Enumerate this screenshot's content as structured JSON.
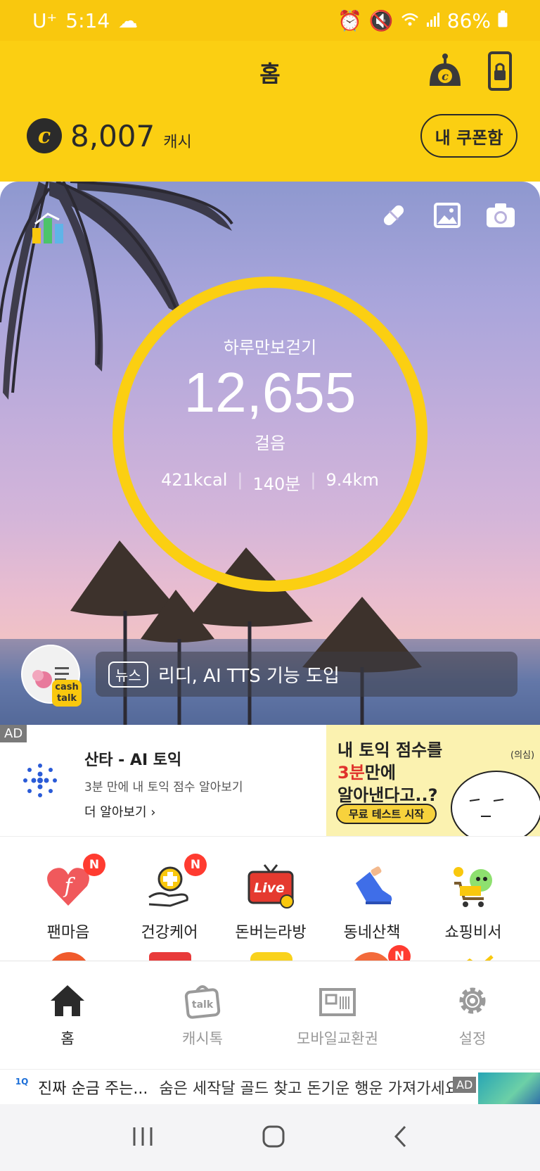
{
  "status_bar": {
    "carrier": "U⁺",
    "time": "5:14",
    "battery": "86%"
  },
  "header": {
    "title": "홈",
    "cash_amount": "8,007",
    "cash_unit": "캐시",
    "coupon_button": "내 쿠폰함",
    "coin_letter": "c"
  },
  "steps": {
    "label": "하루만보걷기",
    "count": "12,655",
    "unit": "걸음",
    "kcal": "421kcal",
    "minutes": "140분",
    "distance": "9.4km",
    "ring_color": "#fbcf12"
  },
  "news": {
    "tag": "뉴스",
    "text": "리디, AI TTS 기능 도입",
    "badge_line1": "cash",
    "badge_line2": "talk"
  },
  "ad": {
    "badge": "AD",
    "title": "산타 - AI 토익",
    "subtitle": "3분 만에 내 토익 점수 알아보기",
    "more": "더 알아보기",
    "banner_line1": "내 토익 점수를",
    "banner_line2_red": "3분",
    "banner_line2_rest": "만에",
    "banner_line3": "알아낸다고..?",
    "banner_cta": "무료 테스트 시작",
    "banner_doubt": "(의심)"
  },
  "menu": {
    "items": [
      {
        "label": "팬마음",
        "badge": "N",
        "icon": "fan-heart-icon"
      },
      {
        "label": "건강케어",
        "badge": "N",
        "icon": "health-care-icon"
      },
      {
        "label": "돈버는라방",
        "badge": "",
        "icon": "live-tv-icon",
        "live": "Live"
      },
      {
        "label": "동네산책",
        "badge": "",
        "icon": "sneaker-icon"
      },
      {
        "label": "쇼핑비서",
        "badge": "",
        "icon": "shopping-cart-icon"
      }
    ],
    "second_row_badge": "N"
  },
  "bottom_nav": {
    "items": [
      {
        "label": "홈",
        "icon": "home-icon",
        "active": true
      },
      {
        "label": "캐시톡",
        "icon": "cashtalk-bag-icon",
        "active": false
      },
      {
        "label": "모바일교환권",
        "icon": "voucher-icon",
        "active": false
      },
      {
        "label": "설정",
        "icon": "gear-icon",
        "active": false
      }
    ]
  },
  "bottom_ad": {
    "logo": "1Q",
    "text1": "진짜 순금 주는...",
    "text2": "숨은 세작달 골드 찾고 돈기운 행운 가져가세요",
    "badge": "AD"
  },
  "colors": {
    "brand_yellow": "#fbcf12",
    "badge_red": "#ff3b30"
  }
}
